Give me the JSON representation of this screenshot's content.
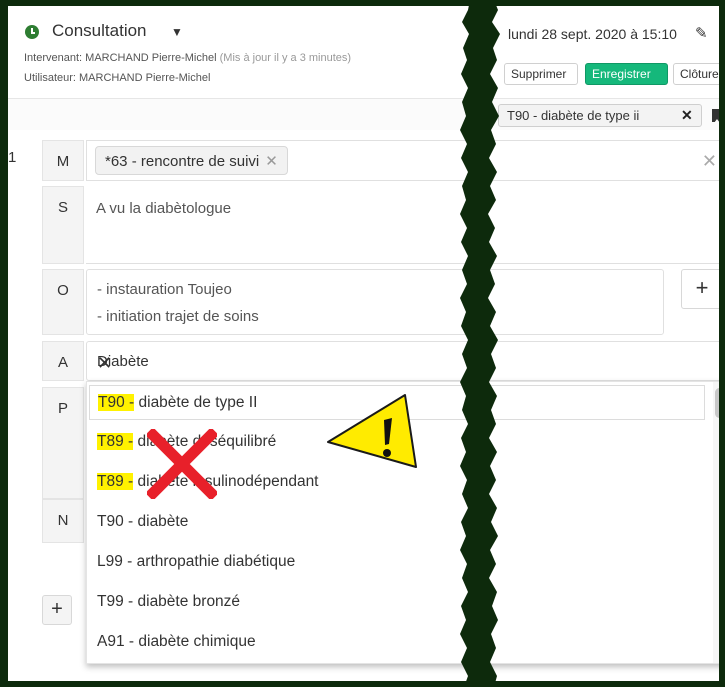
{
  "header": {
    "title": "Consultation",
    "intervenant_label": "Intervenant: MARCHAND Pierre-Michel",
    "updated": "(Mis à jour il y a 3 minutes)",
    "user_label": "Utilisateur: MARCHAND Pierre-Michel",
    "date": "lundi 28 sept. 2020 à 15:10",
    "buttons": {
      "delete": "Supprimer",
      "save": "Enregistrer",
      "close": "Clôturer"
    },
    "save_color": "#15b87b"
  },
  "diagnosis_tag": "T90 - diabète de type ii",
  "row_number": "1",
  "soap": {
    "m": {
      "label": "M",
      "chip": "*63 - rencontre de suivi"
    },
    "s": {
      "label": "S",
      "text": "A vu la diabètologue"
    },
    "o": {
      "label": "O",
      "lines": [
        "- instauration Toujeo",
        "- initiation trajet de soins"
      ]
    },
    "a": {
      "label": "A",
      "value": "Diabète"
    },
    "p": {
      "label": "P"
    },
    "n": {
      "label": "N"
    }
  },
  "dropdown": [
    {
      "code": "T90 -",
      "label": "diabète de type II",
      "highlight": true
    },
    {
      "code": "T89 -",
      "label": "diabète déséquilibré",
      "highlight": true
    },
    {
      "code": "T89 -",
      "label": "diabète insulinodépendant",
      "highlight": true
    },
    {
      "code": "T90 -",
      "label": "diabète",
      "highlight": false
    },
    {
      "code": "L99 -",
      "label": "arthropathie diabétique",
      "highlight": false
    },
    {
      "code": "T99 -",
      "label": "diabète bronzé",
      "highlight": false
    },
    {
      "code": "A91 -",
      "label": "diabète chimique",
      "highlight": false
    }
  ],
  "icons": [
    "clock-icon",
    "caret-down-icon",
    "pencil-icon",
    "close-icon",
    "bookmark-icon",
    "plus-icon",
    "warning-icon",
    "red-cross-icon"
  ],
  "colors": {
    "highlight": "#fff200",
    "warning": "#ffeb00",
    "cross": "#e8202a",
    "frame": "#0d2a0c"
  }
}
